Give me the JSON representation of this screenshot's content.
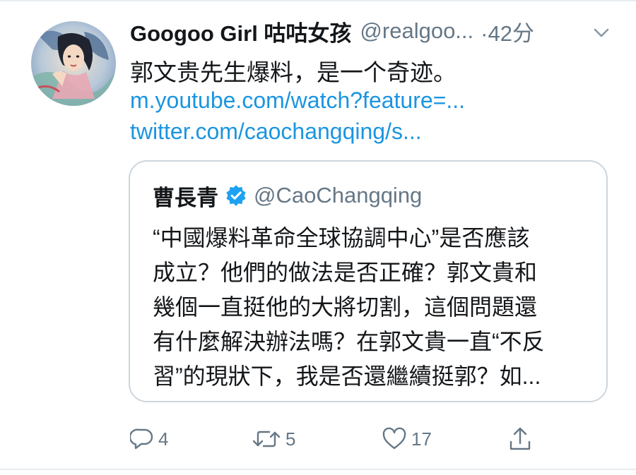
{
  "tweet": {
    "display_name": "Googoo Girl 咕咕女孩",
    "handle": "@realgoo...",
    "time": "·42分",
    "text": "郭文贵先生爆料，是一个奇迹。",
    "links": [
      "m.youtube.com/watch?feature=...",
      "twitter.com/caochangqing/s..."
    ]
  },
  "quote": {
    "name": "曹長青",
    "handle": "@CaoChangqing",
    "lines": [
      "“中國爆料革命全球協調中心”是否應該",
      "成立？他們的做法是否正確？郭文貴和",
      "幾個一直挺他的大將切割，這個問題還",
      "有什麼解決辦法嗎？在郭文貴一直“不反",
      "習”的現狀下，我是否還繼續挺郭？如..."
    ]
  },
  "actions": {
    "reply_count": "4",
    "retweet_count": "5",
    "like_count": "17"
  },
  "colors": {
    "link": "#1b95e0",
    "secondary_text": "#657786",
    "verified": "#1da1f2",
    "border": "#ccd6dd"
  },
  "icons": [
    "avatar",
    "chevron-down-icon",
    "verified-badge-icon",
    "reply-icon",
    "retweet-icon",
    "like-icon",
    "share-icon"
  ]
}
